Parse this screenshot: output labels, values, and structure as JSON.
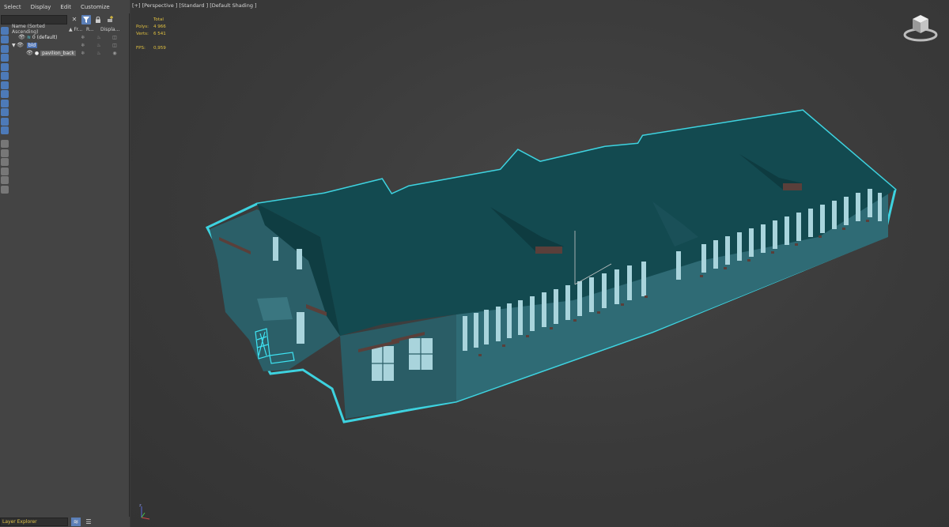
{
  "menu": [
    "Select",
    "Display",
    "Edit",
    "Customize"
  ],
  "search": {
    "placeholder": "",
    "value": ""
  },
  "tree": {
    "columns": {
      "name": "Name (Sorted Ascending)",
      "frozen": "▲ Fr...",
      "render": "R...",
      "display": "Displa..."
    },
    "rows": [
      {
        "name": "0 (default)"
      },
      {
        "name": "bld"
      },
      {
        "name": "pavilion_back"
      }
    ]
  },
  "bottom": {
    "explorer_name": "Layer Explorer"
  },
  "viewport": {
    "label": "[+] [Perspective ] [Standard ] [Default Shading ]",
    "stats": {
      "header": "Total",
      "polys_label": "Polys:",
      "polys_value": "4 966",
      "verts_label": "Verts:",
      "verts_value": "6 541",
      "fps_label": "FPS:",
      "fps_value": "0,959"
    }
  },
  "icons": {
    "toolbar": [
      "close-icon",
      "filter-icon",
      "lock-icon",
      "add-layer-icon"
    ],
    "tree": [
      "eye-icon",
      "layer-stack-icon",
      "expand-arrow-icon",
      "object-dot-icon",
      "freeze-icon",
      "render-teapot-icon",
      "display-box-icon"
    ],
    "viewcube": "viewcube-icon",
    "axis": "axis-tripod-icon"
  },
  "colors": {
    "selection_outline": "#3ee3f2",
    "roof": "#134a50",
    "walls": "#2f6b75",
    "windows": "#a9d4dc",
    "stats_text": "#e0c040",
    "highlight": "#4a6fb0"
  }
}
